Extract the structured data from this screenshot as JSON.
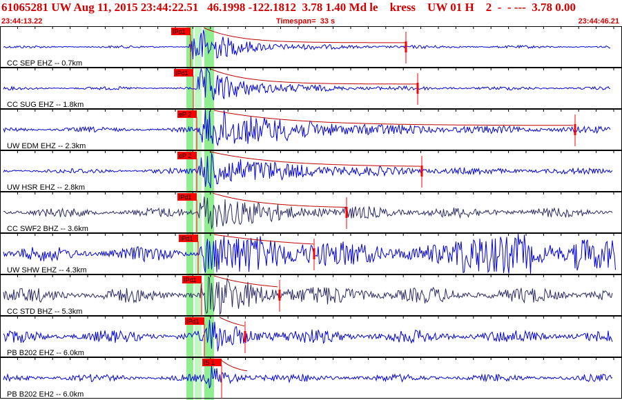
{
  "header": {
    "title": "61065281 UW Aug 11, 2015 23:44:22.51   46.1998 -122.1812  3.78 1.40 Md le    kress    UW 01 H    2  -  - ---  3.78 0.00",
    "start_time": "23:44:13.22",
    "timespan_label": "Timespan=",
    "timespan_value": "33 s",
    "end_time": "23:44:46.21"
  },
  "colors": {
    "trace_ehz": "#0000e0",
    "trace_bhz": "#2a2a66",
    "pick": "#ff0000",
    "coda": "#c00000",
    "window": "#90ee90",
    "frame": "#000000"
  },
  "channels": [
    {
      "label": "CC SEP EHZ -- 0.7km",
      "pick": "IPd1"
    },
    {
      "label": "CC SUG EHZ -- 1.8km",
      "pick": "IPd1"
    },
    {
      "label": "UW EDM EHZ -- 2.3km",
      "pick": "eP 2"
    },
    {
      "label": "UW HSR EHZ -- 2.8km",
      "pick": "eP 2"
    },
    {
      "label": "CC SWF2 BHZ -- 3.6km",
      "pick": "IPd1"
    },
    {
      "label": "UW SHW EHZ -- 4.3km",
      "pick": "IPd1"
    },
    {
      "label": "CC STD BHZ -- 5.3km",
      "pick": "IPd1"
    },
    {
      "label": "PB B202 EHZ -- 6.0km",
      "pick": "IPd1"
    },
    {
      "label": "PB B202 EH2 -- 6.0km",
      "pick": "IS 1"
    }
  ]
}
